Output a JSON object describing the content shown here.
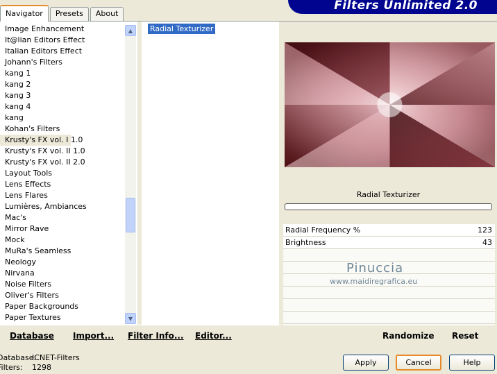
{
  "app": {
    "title": "Filters Unlimited 2.0"
  },
  "tabs": [
    {
      "label": "Navigator",
      "active": true
    },
    {
      "label": "Presets",
      "active": false
    },
    {
      "label": "About",
      "active": false
    }
  ],
  "categories": {
    "items": [
      "Image Enhancement",
      "It@lian Editors Effect",
      "Italian Editors Effect",
      "Johann's Filters",
      "kang 1",
      "kang 2",
      "kang 3",
      "kang 4",
      "kang",
      "Kohan's Filters",
      "Krusty's FX vol. I 1.0",
      "Krusty's FX vol. II 1.0",
      "Krusty's FX vol. II 2.0",
      "Layout Tools",
      "Lens Effects",
      "Lens Flares",
      "Lumières, Ambiances",
      "Mac's",
      "Mirror Rave",
      "Mock",
      "MuRa's Seamless",
      "Neology",
      "Nirvana",
      "Noise Filters",
      "Oliver's Filters",
      "Paper Backgrounds",
      "Paper Textures"
    ],
    "selected_index": 10
  },
  "filters": {
    "items": [
      "Radial Texturizer"
    ],
    "selected": "Radial Texturizer"
  },
  "preview": {
    "filter_name": "Radial Texturizer"
  },
  "params": [
    {
      "label": "Radial Frequency %",
      "value": "123"
    },
    {
      "label": "Brightness",
      "value": "43"
    }
  ],
  "watermark": {
    "name": "Pinuccia",
    "url": "www.maidiregrafica.eu"
  },
  "bottom_links": {
    "database": "Database",
    "import": "Import...",
    "filter_info": "Filter Info...",
    "editor": "Editor...",
    "randomize": "Randomize",
    "reset": "Reset"
  },
  "status": {
    "database_label": "Database:",
    "database_value": "ICNET-Filters",
    "filters_label": "Filters:",
    "filters_value": "1298"
  },
  "buttons": {
    "apply": "Apply",
    "cancel": "Cancel",
    "help": "Help"
  },
  "colors": {
    "accent": "#00048f",
    "selection": "#316ac5",
    "tab_highlight": "#e68b2c",
    "dialog_bg": "#ece9d8"
  },
  "icons": {
    "scroll_up": "chevron-up-icon",
    "scroll_down": "chevron-down-icon"
  }
}
